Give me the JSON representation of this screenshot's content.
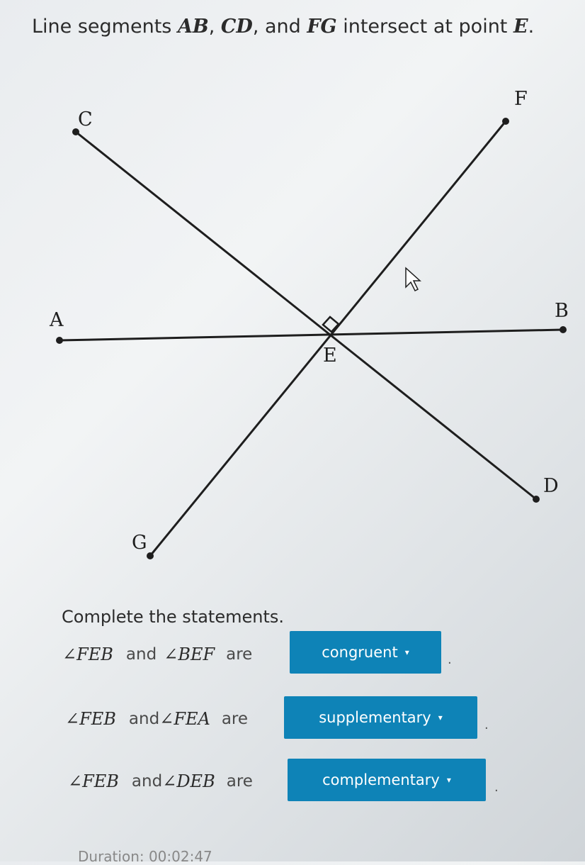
{
  "header": {
    "prefix": "Line segments",
    "seg1": "AB",
    "seg2": "CD",
    "conj": ", and",
    "seg3": "FG",
    "suffix": "intersect at point",
    "point": "E",
    "end": "."
  },
  "diagram": {
    "labels": {
      "A": "A",
      "B": "B",
      "C": "C",
      "D": "D",
      "E": "E",
      "F": "F",
      "G": "G"
    },
    "right_angle_at": "E"
  },
  "prompt": "Complete the statements.",
  "statements": [
    {
      "angle1": "∠FEB",
      "and": "and",
      "angle2": "∠BEF",
      "are": "are",
      "answer": "congruent",
      "caret": "▾"
    },
    {
      "angle1": "∠FEB",
      "and": "and",
      "angle2": "∠FEA",
      "are": "are",
      "answer": "supplementary",
      "caret": "▾"
    },
    {
      "angle1": "∠FEB",
      "and": "and",
      "angle2": "∠DEB",
      "are": "are",
      "answer": "complementary",
      "caret": "▾"
    }
  ],
  "duration": "Duration: 00:02:47",
  "colors": {
    "dropdown": "#0e83b7",
    "line": "#1e1e1e"
  }
}
